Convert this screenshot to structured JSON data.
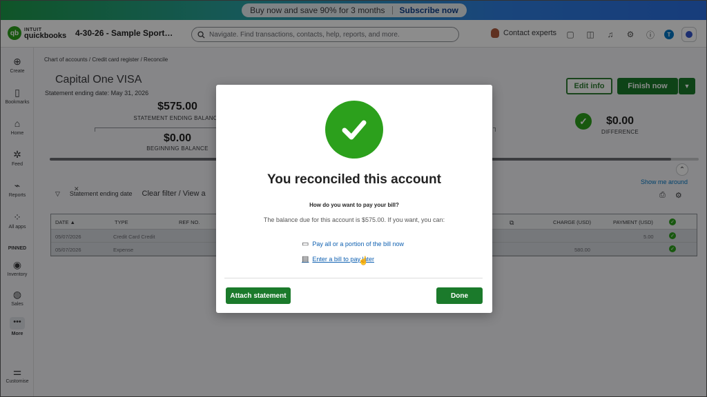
{
  "promo": {
    "text": "Buy now and save 90% for 3 months",
    "cta": "Subscribe now"
  },
  "topbar": {
    "logo_line1": "INTUIT",
    "logo_line2": "quickbooks",
    "logo_mark": "qb",
    "company": "4-30-26 - Sample Sport…",
    "search_placeholder": "Navigate. Find transactions, contacts, help, reports, and more.",
    "contact": "Contact experts",
    "avatar_letter": "T"
  },
  "sidebar": {
    "items": [
      {
        "label": "Create",
        "icon": "plus-circle-icon"
      },
      {
        "label": "Bookmarks",
        "icon": "bookmark-icon"
      },
      {
        "label": "Home",
        "icon": "home-icon"
      },
      {
        "label": "Feed",
        "icon": "sparkle-icon"
      },
      {
        "label": "Reports",
        "icon": "chart-icon"
      },
      {
        "label": "All apps",
        "icon": "grid-icon"
      }
    ],
    "pinned_label": "PINNED",
    "pinned": [
      {
        "label": "Inventory",
        "icon": "inventory-icon"
      },
      {
        "label": "Sales",
        "icon": "sales-icon"
      },
      {
        "label": "More",
        "icon": "more-icon"
      }
    ],
    "customise": "Customise"
  },
  "main": {
    "breadcrumb": "Chart of accounts  /  Credit card register  /  Reconcile",
    "account_title": "Capital One VISA",
    "statement_date": "Statement ending date: May 31, 2026",
    "edit_info": "Edit info",
    "finish_now": "Finish now",
    "statement_ending_balance": "$575.00",
    "statement_ending_balance_label": "STATEMENT ENDING BALANCE",
    "beginning_balance": "$0.00",
    "beginning_balance_label": "BEGINNING BALANCE",
    "difference": "$0.00",
    "difference_label": "DIFFERENCE",
    "show_me_around": "Show me around",
    "filter_label": "Statement ending date",
    "clear_filter": "Clear filter / View a"
  },
  "table": {
    "headers": [
      "DATE ▲",
      "TYPE",
      "REF NO.",
      "CHARGE (USD)",
      "PAYMENT (USD)"
    ],
    "rows": [
      {
        "date": "05/07/2026",
        "type": "Credit Card Credit",
        "charge": "",
        "payment": "5.00"
      },
      {
        "date": "05/07/2026",
        "type": "Expense",
        "charge": "580.00",
        "payment": ""
      }
    ]
  },
  "modal": {
    "title": "You reconciled this account",
    "question": "How do you want to pay your bill?",
    "description": "The balance due for this account is $575.00. If you want, you can:",
    "link_pay": "Pay all or a portion of the bill now",
    "link_bill": "Enter a bill to pay later",
    "attach": "Attach statement",
    "done": "Done"
  }
}
